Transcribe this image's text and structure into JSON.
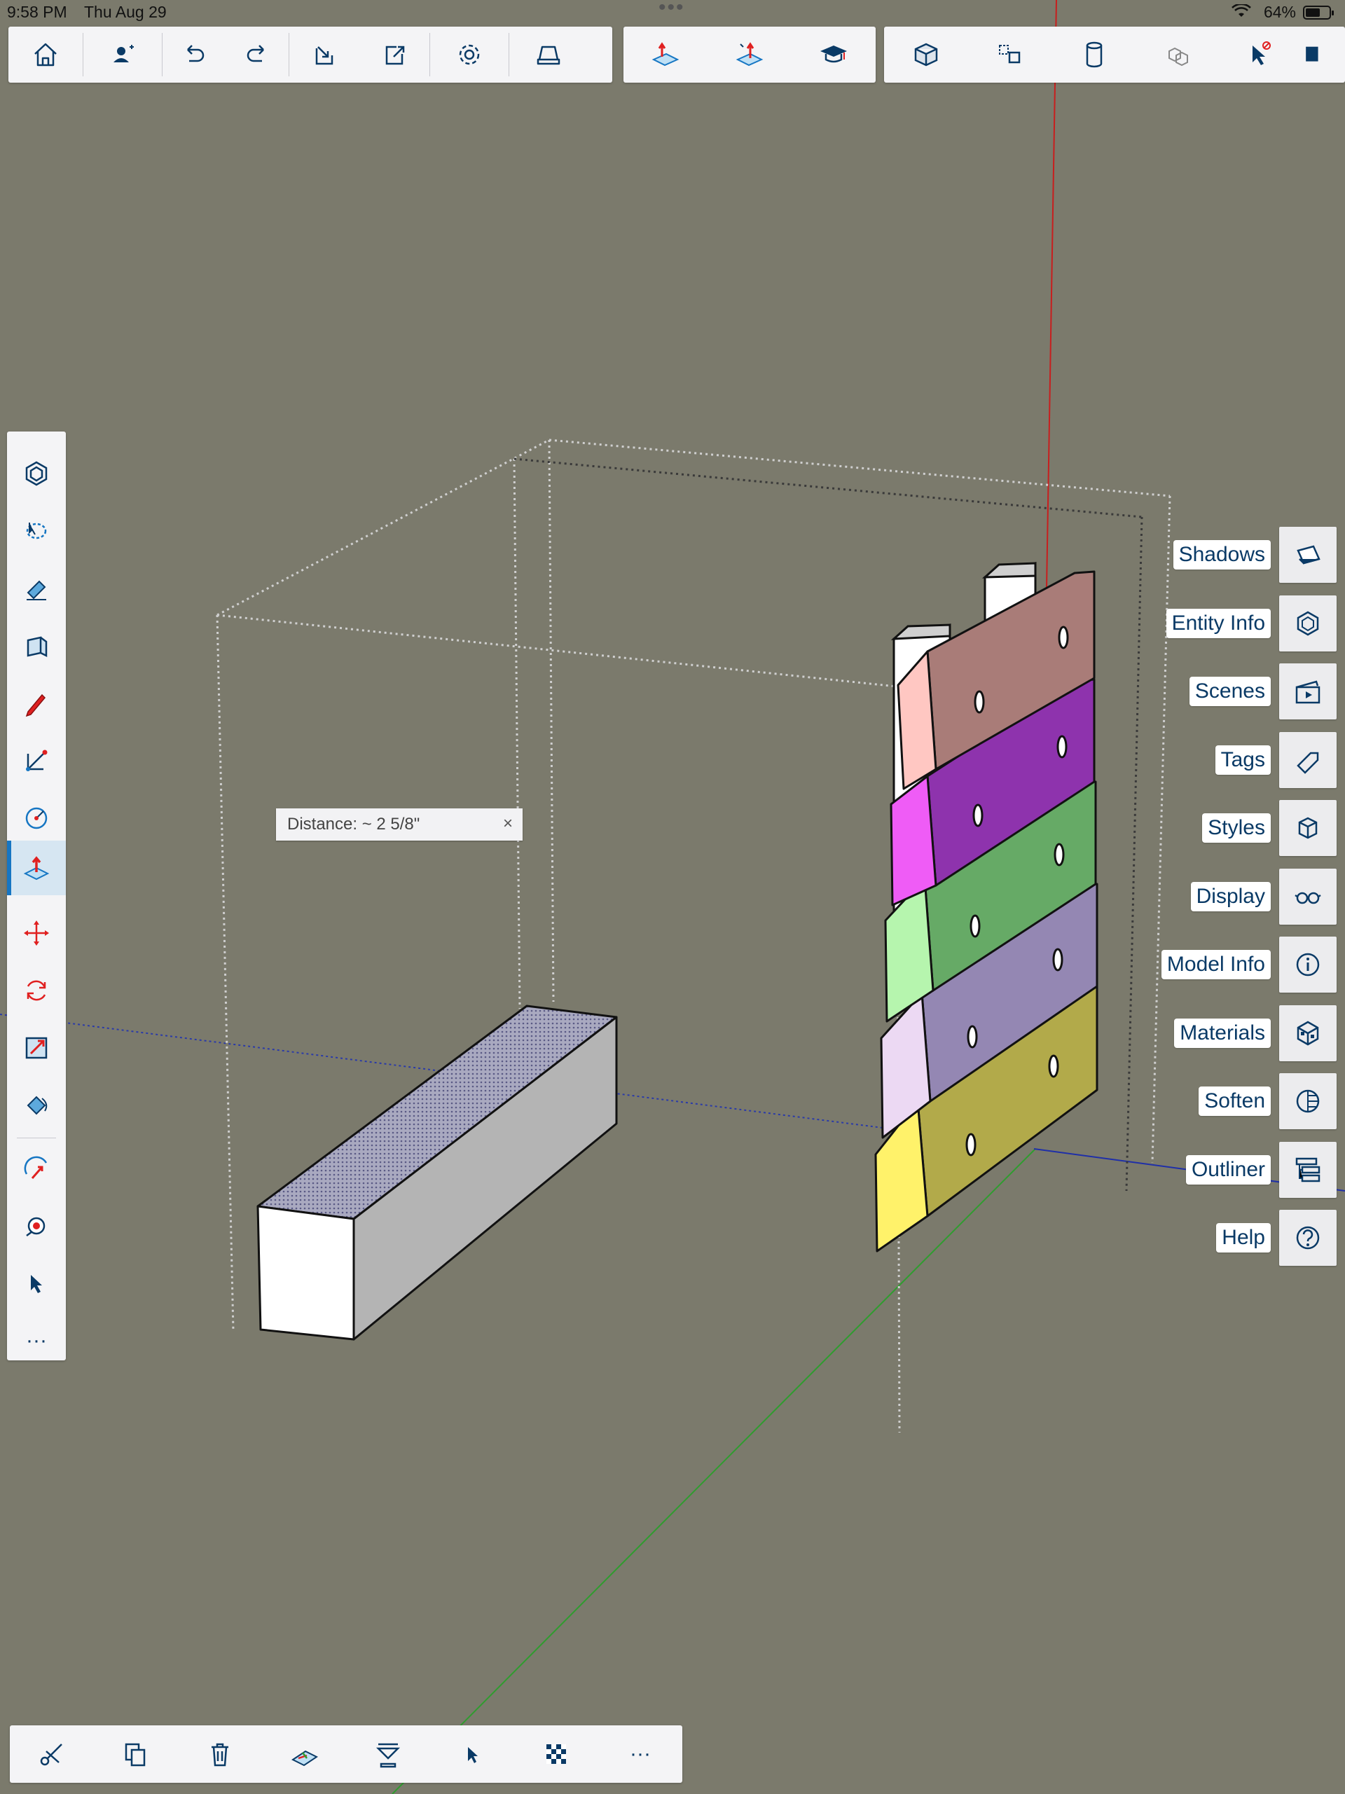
{
  "status": {
    "time": "9:58 PM",
    "date": "Thu Aug 29",
    "battery": "64%",
    "battery_level": 0.64
  },
  "top_toolbar": {
    "group1": [
      "home-icon",
      "user-add-icon",
      "undo-icon",
      "redo-icon",
      "import-icon",
      "export-icon",
      "settings-icon",
      "print-icon"
    ],
    "group2": [
      "push-pull-icon",
      "extrude-icon",
      "graduation-cap-icon"
    ],
    "group3": [
      "solid-cube-icon",
      "components-icon",
      "cylinder-icon",
      "group-cubes-icon",
      "select-no-icon",
      "more-tools-icon"
    ]
  },
  "left_toolbar": {
    "tools": [
      "component-icon",
      "lasso-icon",
      "eraser-icon",
      "rectangle-box-icon",
      "pencil-icon",
      "rectangle-icon",
      "circle-icon",
      "push-pull-icon",
      "move-icon",
      "rotate-icon",
      "scale-icon",
      "paint-bucket-icon",
      "follow-me-icon",
      "tape-measure-icon",
      "select-icon"
    ],
    "more_label": "···",
    "active_tool": "push-pull-icon"
  },
  "right_panel": [
    {
      "label": "Shadows",
      "icon": "shadows-icon"
    },
    {
      "label": "Entity Info",
      "icon": "entity-info-icon"
    },
    {
      "label": "Scenes",
      "icon": "scenes-icon"
    },
    {
      "label": "Tags",
      "icon": "tags-icon"
    },
    {
      "label": "Styles",
      "icon": "styles-icon"
    },
    {
      "label": "Display",
      "icon": "display-icon"
    },
    {
      "label": "Model Info",
      "icon": "model-info-icon"
    },
    {
      "label": "Materials",
      "icon": "materials-icon"
    },
    {
      "label": "Soften",
      "icon": "soften-icon"
    },
    {
      "label": "Outliner",
      "icon": "outliner-icon"
    },
    {
      "label": "Help",
      "icon": "help-icon"
    }
  ],
  "measurement": {
    "text": "Distance: ~ 2 5/8\"",
    "close": "×"
  },
  "bottom_toolbar": [
    "cut-icon",
    "copy-icon",
    "delete-icon",
    "paste-in-place-icon",
    "flip-icon",
    "select-arrow-icon",
    "checker-icon",
    "more-icon"
  ],
  "bottom_more_label": "···",
  "colors": {
    "background": "#7b7a6c",
    "accent": "#1676c3",
    "icon": "#0a3a66",
    "red_axis": "#c81e1e",
    "green_axis": "#2f9c2f",
    "blue_axis": "#1f2fa8",
    "block_colors": [
      "#a97c78",
      "#8e33ad",
      "#66aa66",
      "#9487b3",
      "#b2aa4a"
    ]
  }
}
